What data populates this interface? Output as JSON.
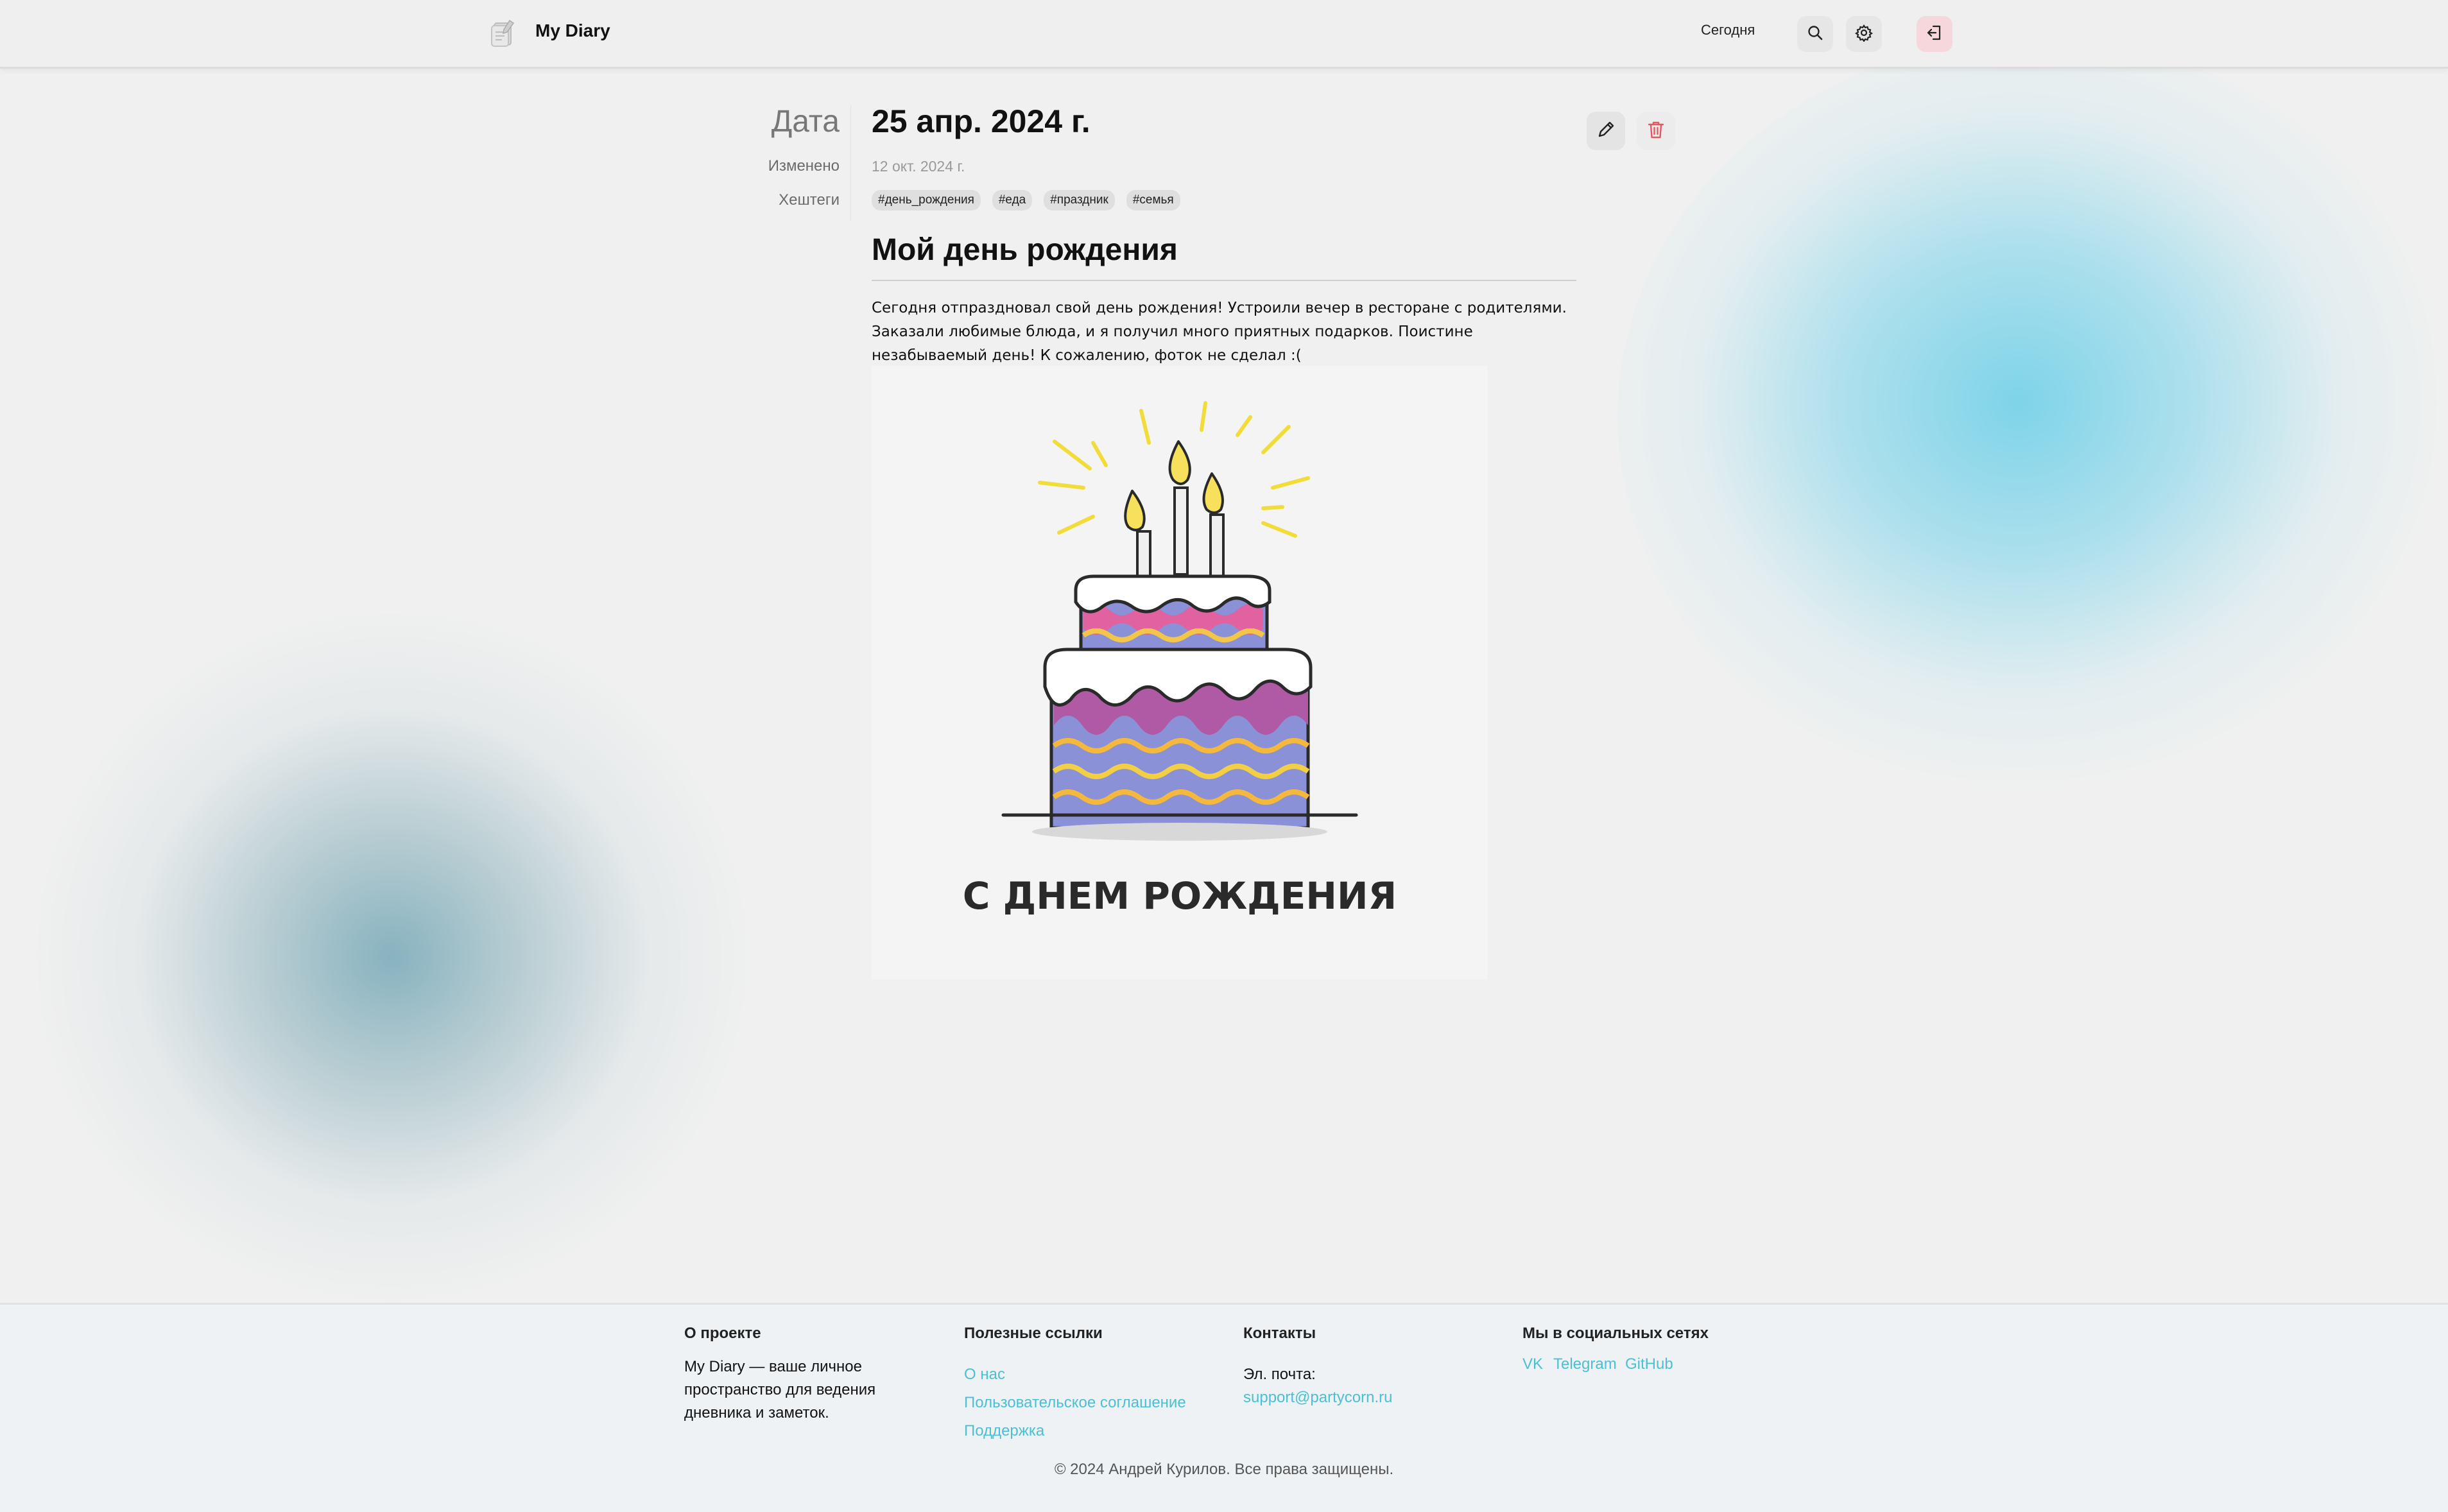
{
  "header": {
    "brand": "My Diary",
    "today_label": "Сегодня",
    "icons": [
      "diary-logo-icon",
      "search-icon",
      "gear-icon",
      "logout-icon"
    ],
    "logout_accent": "#f6d7db"
  },
  "entry": {
    "labels": {
      "date": "Дата",
      "modified": "Изменено",
      "hashtags": "Хештеги"
    },
    "date": "25 апр. 2024 г.",
    "modified": "12 окт. 2024 г.",
    "hashtags": [
      "#день_рождения",
      "#еда",
      "#праздник",
      "#семья"
    ],
    "title": "Мой день рождения",
    "body": "Сегодня отпраздновал свой день рождения! Устроили вечер в ресторане с родителями. Заказали любимые блюда, и я получил много приятных подарков. Поистине незабываемый день! К сожалению, фоток не сделал :(",
    "image_caption": "С ДНЕМ РОЖДЕНИЯ",
    "actions": {
      "edit_icon": "pencil-icon",
      "delete_icon": "trash-icon",
      "delete_color": "#e05a64"
    }
  },
  "footer": {
    "about": {
      "heading": "О проекте",
      "text": "My Diary — ваше личное пространство для ведения дневника и заметок."
    },
    "links": {
      "heading": "Полезные ссылки",
      "items": [
        "О нас",
        "Пользовательское соглашение",
        "Поддержка"
      ]
    },
    "contacts": {
      "heading": "Контакты",
      "email_label": "Эл. почта:",
      "email": "support@partycorn.ru"
    },
    "social": {
      "heading": "Мы в социальных сетях",
      "items": [
        "VK",
        "Telegram",
        "GitHub"
      ]
    },
    "copyright": "© 2024 Андрей Курилов. Все права защищены.",
    "link_color": "#4bbfd3"
  }
}
